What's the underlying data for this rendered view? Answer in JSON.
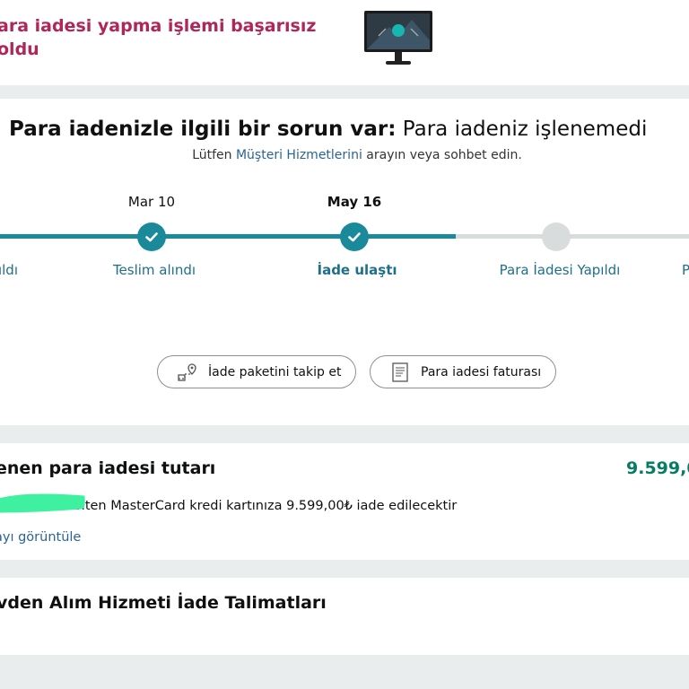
{
  "header": {
    "error_title": "ara iadesi yapma işlemi başarısız oldu"
  },
  "status": {
    "problem_heading_bold": "Para iadenizle ilgili bir sorun var:",
    "problem_heading_rest": " Para iadeniz işlenemedi",
    "contact_prefix": "Lütfen ",
    "contact_link": "Müşteri Hizmetlerini",
    "contact_suffix": " arayın veya sohbet edin.",
    "steps": [
      {
        "date": "",
        "label": "ıldı",
        "state": "done"
      },
      {
        "date": "Mar 10",
        "label": "Teslim alındı",
        "state": "done"
      },
      {
        "date": "May 16",
        "label": "İade ulaştı",
        "state": "current"
      },
      {
        "date": "",
        "label": "Para İadesi Yapıldı",
        "state": "todo"
      },
      {
        "date": "",
        "label": "P",
        "state": "todo"
      }
    ],
    "colors": {
      "progress": "#1a8a9a",
      "pending": "#d9dcdc",
      "link": "#1f6f8b"
    }
  },
  "actions": {
    "track_package_label": "İade paketini takip et",
    "track_package_icon": "package-tracking-icon",
    "refund_invoice_label": "Para iadesi faturası",
    "refund_invoice_icon": "invoice-icon"
  },
  "amount": {
    "title": "enen para iadesi tutarı",
    "value": "9.599,0",
    "note": "ile biten MasterCard kredi kartınıza 9.599,00₺ iade edilecektir",
    "view_link": "ayı görüntüle",
    "value_color": "#067d62"
  },
  "instructions": {
    "title": "vden Alım Hizmeti İade Talimatları"
  }
}
